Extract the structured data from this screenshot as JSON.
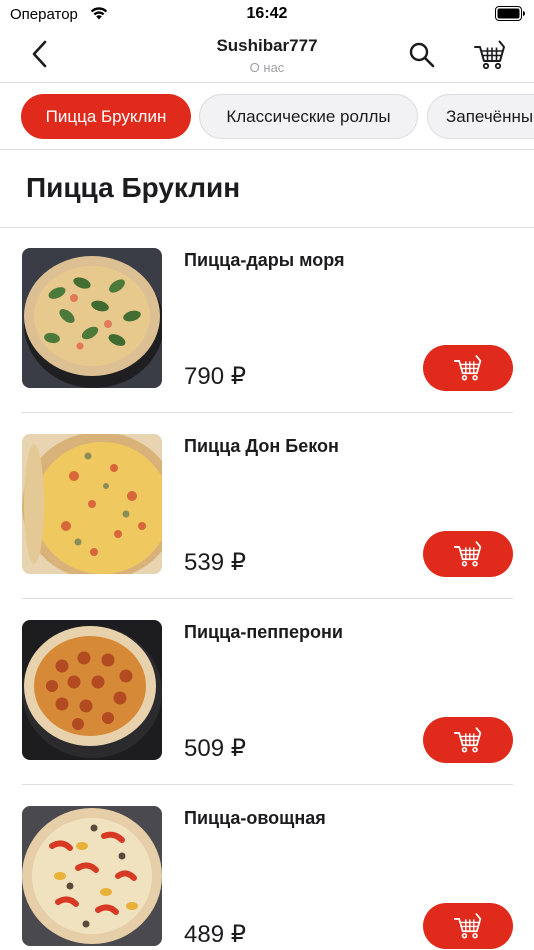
{
  "status_bar": {
    "carrier": "Оператор",
    "time": "16:42"
  },
  "header": {
    "title": "Sushibar777",
    "subtitle": "О нас"
  },
  "categories": [
    {
      "label": "Пицца Бруклин",
      "active": true
    },
    {
      "label": "Классические роллы",
      "active": false
    },
    {
      "label": "Запечённы",
      "active": false
    }
  ],
  "section": {
    "title": "Пицца Бруклин"
  },
  "products": [
    {
      "name": "Пицца-дары моря",
      "price": "790 ₽"
    },
    {
      "name": "Пицца Дон Бекон",
      "price": "539 ₽"
    },
    {
      "name": "Пицца-пепперони",
      "price": "509 ₽"
    },
    {
      "name": "Пицца-овощная",
      "price": "489 ₽"
    }
  ],
  "colors": {
    "accent": "#e02a1b",
    "divider": "#dedede",
    "muted_text": "#a0a0a5"
  },
  "icons": {
    "back": "chevron-left-icon",
    "search": "search-icon",
    "cart": "cart-icon",
    "add_to_cart": "cart-icon"
  }
}
